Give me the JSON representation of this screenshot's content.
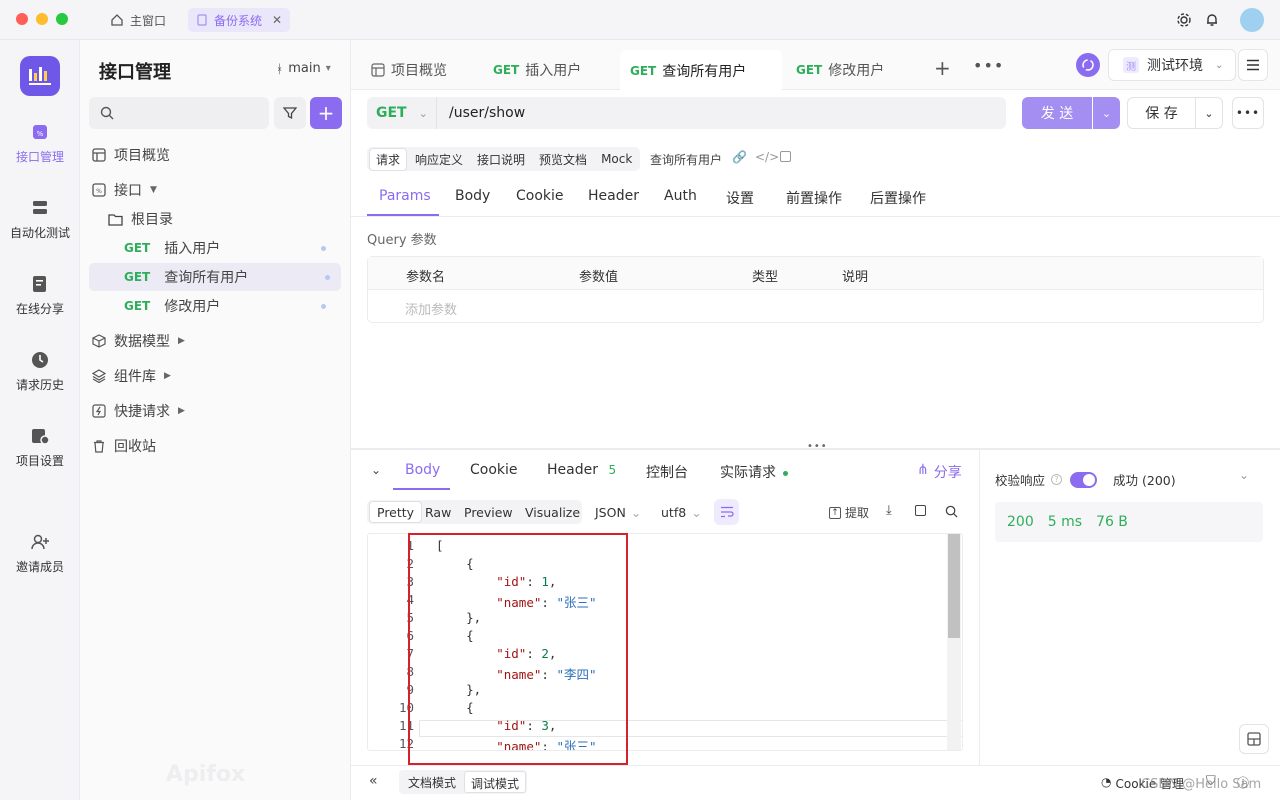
{
  "window": {
    "tabs": [
      {
        "label": "主窗口",
        "icon": "home-icon"
      },
      {
        "label": "备份系统",
        "icon": "doc-icon"
      }
    ]
  },
  "nav": {
    "items": [
      {
        "label": "接口管理",
        "icon": "api-icon"
      },
      {
        "label": "自动化测试",
        "icon": "automation-icon"
      },
      {
        "label": "在线分享",
        "icon": "share-doc-icon"
      },
      {
        "label": "请求历史",
        "icon": "history-icon"
      },
      {
        "label": "项目设置",
        "icon": "settings-icon"
      },
      {
        "label": "邀请成员",
        "icon": "add-user-icon"
      }
    ],
    "logo_text": "Apifox"
  },
  "sidebar": {
    "title": "接口管理",
    "branch": "main",
    "tree": {
      "overview": "项目概览",
      "api": "接口",
      "root": "根目录",
      "endpoints": [
        {
          "method": "GET",
          "name": "插入用户"
        },
        {
          "method": "GET",
          "name": "查询所有用户"
        },
        {
          "method": "GET",
          "name": "修改用户"
        }
      ],
      "models": "数据模型",
      "components": "组件库",
      "quick": "快捷请求",
      "trash": "回收站"
    }
  },
  "tabs": [
    {
      "method": "",
      "label": "项目概览"
    },
    {
      "method": "GET",
      "label": "插入用户"
    },
    {
      "method": "GET",
      "label": "查询所有用户"
    },
    {
      "method": "GET",
      "label": "修改用户"
    }
  ],
  "env": {
    "badge": "测",
    "label": "测试环境"
  },
  "request": {
    "method": "GET",
    "url": "/user/show",
    "send": "发 送",
    "save": "保 存",
    "subtabs": [
      "请求",
      "响应定义",
      "接口说明",
      "预览文档",
      "Mock"
    ],
    "name": "查询所有用户",
    "paramtabs": [
      "Params",
      "Body",
      "Cookie",
      "Header",
      "Auth",
      "设置",
      "前置操作",
      "后置操作"
    ],
    "query_title": "Query 参数",
    "columns": [
      "参数名",
      "参数值",
      "类型",
      "说明"
    ],
    "add_param": "添加参数"
  },
  "response": {
    "tabs": [
      "Body",
      "Cookie",
      "Header",
      "控制台",
      "实际请求"
    ],
    "header_count": "5",
    "share": "分享",
    "views": [
      "Pretty",
      "Raw",
      "Preview",
      "Visualize"
    ],
    "format": "JSON",
    "encoding": "utf8",
    "extract": "提取",
    "lines": [
      {
        "n": "1",
        "t": "["
      },
      {
        "n": "2",
        "t": "    {"
      },
      {
        "n": "3",
        "k": "\"id\"",
        "v": "1",
        "num": true,
        "s": ","
      },
      {
        "n": "4",
        "k": "\"name\"",
        "v": "\"张三\"",
        "num": false,
        "s": ""
      },
      {
        "n": "5",
        "t": "    },"
      },
      {
        "n": "6",
        "t": "    {"
      },
      {
        "n": "7",
        "k": "\"id\"",
        "v": "2",
        "num": true,
        "s": ","
      },
      {
        "n": "8",
        "k": "\"name\"",
        "v": "\"李四\"",
        "num": false,
        "s": ""
      },
      {
        "n": "9",
        "t": "    },"
      },
      {
        "n": "10",
        "t": "    {"
      },
      {
        "n": "11",
        "k": "\"id\"",
        "v": "3",
        "num": true,
        "s": ","
      },
      {
        "n": "12",
        "k": "\"name\"",
        "v": "\"张三\"",
        "num": false,
        "s": ""
      }
    ],
    "validate": "校验响应",
    "status_text": "成功 (200)",
    "code": "200",
    "time": "5 ms",
    "size": "76 B"
  },
  "footer": {
    "modes": [
      "文档模式",
      "调试模式"
    ],
    "cookie": "Cookie 管理",
    "watermark": "CSDN @Hello Sam"
  },
  "colors": {
    "accent": "#8b6cf0",
    "get": "#2eae5b",
    "highlight": "#d9202a"
  }
}
